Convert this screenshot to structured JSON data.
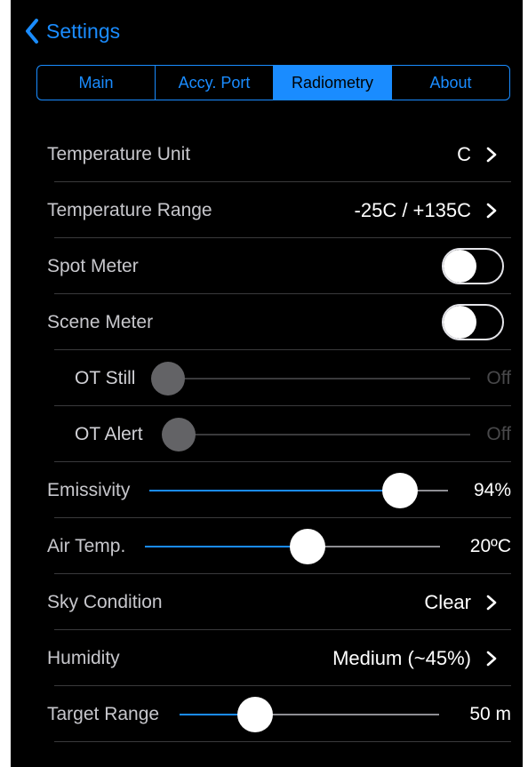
{
  "nav": {
    "back_label": "Settings"
  },
  "tabs": [
    {
      "label": "Main",
      "active": false
    },
    {
      "label": "Accy. Port",
      "active": false
    },
    {
      "label": "Radiometry",
      "active": true
    },
    {
      "label": "About",
      "active": false
    }
  ],
  "settings": {
    "temperature_unit": {
      "label": "Temperature Unit",
      "value": "C"
    },
    "temperature_range": {
      "label": "Temperature Range",
      "value": "-25C / +135C"
    },
    "spot_meter": {
      "label": "Spot Meter",
      "on": false
    },
    "scene_meter": {
      "label": "Scene Meter",
      "on": false
    },
    "ot_still": {
      "label": "OT Still",
      "value": "Off",
      "level": 0
    },
    "ot_alert": {
      "label": "OT Alert",
      "value": "Off",
      "level": 0
    },
    "emissivity": {
      "label": "Emissivity",
      "value": "94%",
      "level": 0.84
    },
    "air_temp": {
      "label": "Air Temp.",
      "value": "20ºC",
      "level": 0.55
    },
    "sky_condition": {
      "label": "Sky Condition",
      "value": "Clear"
    },
    "humidity": {
      "label": "Humidity",
      "value": "Medium (~45%)"
    },
    "target_range": {
      "label": "Target Range",
      "value": "50 m",
      "level": 0.29
    }
  },
  "colors": {
    "accent": "#1a8cff",
    "background": "#000000",
    "divider": "#3a3a3c"
  },
  "icons": {
    "back": "chevron-left-icon",
    "disclosure": "chevron-right-icon"
  }
}
